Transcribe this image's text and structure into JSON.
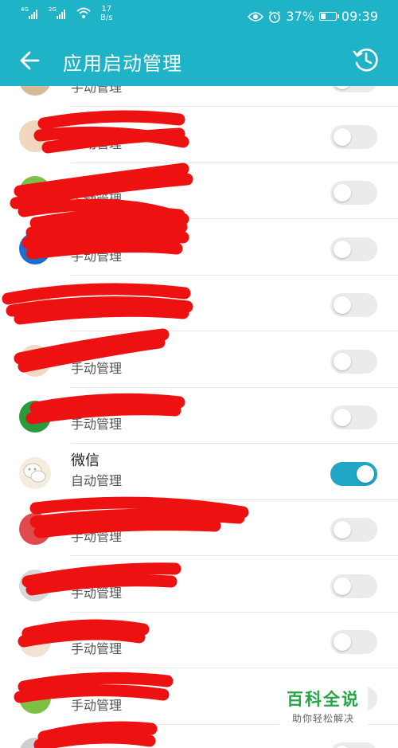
{
  "status_bar": {
    "net1": "4G",
    "net2": "2G",
    "speed_value": "17",
    "speed_unit": "B/s",
    "battery_percent": "37%",
    "battery_level": 0.37,
    "time": "09:39"
  },
  "app_bar": {
    "title": "应用启动管理",
    "back_icon": "back-arrow-icon",
    "history_icon": "history-clock-icon"
  },
  "apps": [
    {
      "sub": "手动管理",
      "enabled": false
    },
    {
      "sub": "手动管理",
      "enabled": false
    },
    {
      "sub": "手动管理",
      "enabled": false
    },
    {
      "sub": "手动管理",
      "enabled": false
    },
    {
      "sub": "手动管理",
      "enabled": false
    },
    {
      "sub": "手动管理",
      "enabled": false
    },
    {
      "sub": "手动管理",
      "enabled": false
    },
    {
      "name": "微信",
      "sub": "自动管理",
      "enabled": true
    },
    {
      "sub": "手动管理",
      "enabled": false
    },
    {
      "sub": "手动管理",
      "enabled": false
    },
    {
      "sub": "手动管理",
      "enabled": false
    },
    {
      "sub": "手动管理",
      "enabled": false
    },
    {
      "sub": "",
      "enabled": false
    }
  ],
  "watermark": {
    "title": "百科全说",
    "subtitle": "助你轻松解决"
  },
  "colors": {
    "accent": "#1fb3c8",
    "toggle_on": "#1fa7c5",
    "redaction": "#ee1111",
    "watermark_green": "#23a548"
  }
}
